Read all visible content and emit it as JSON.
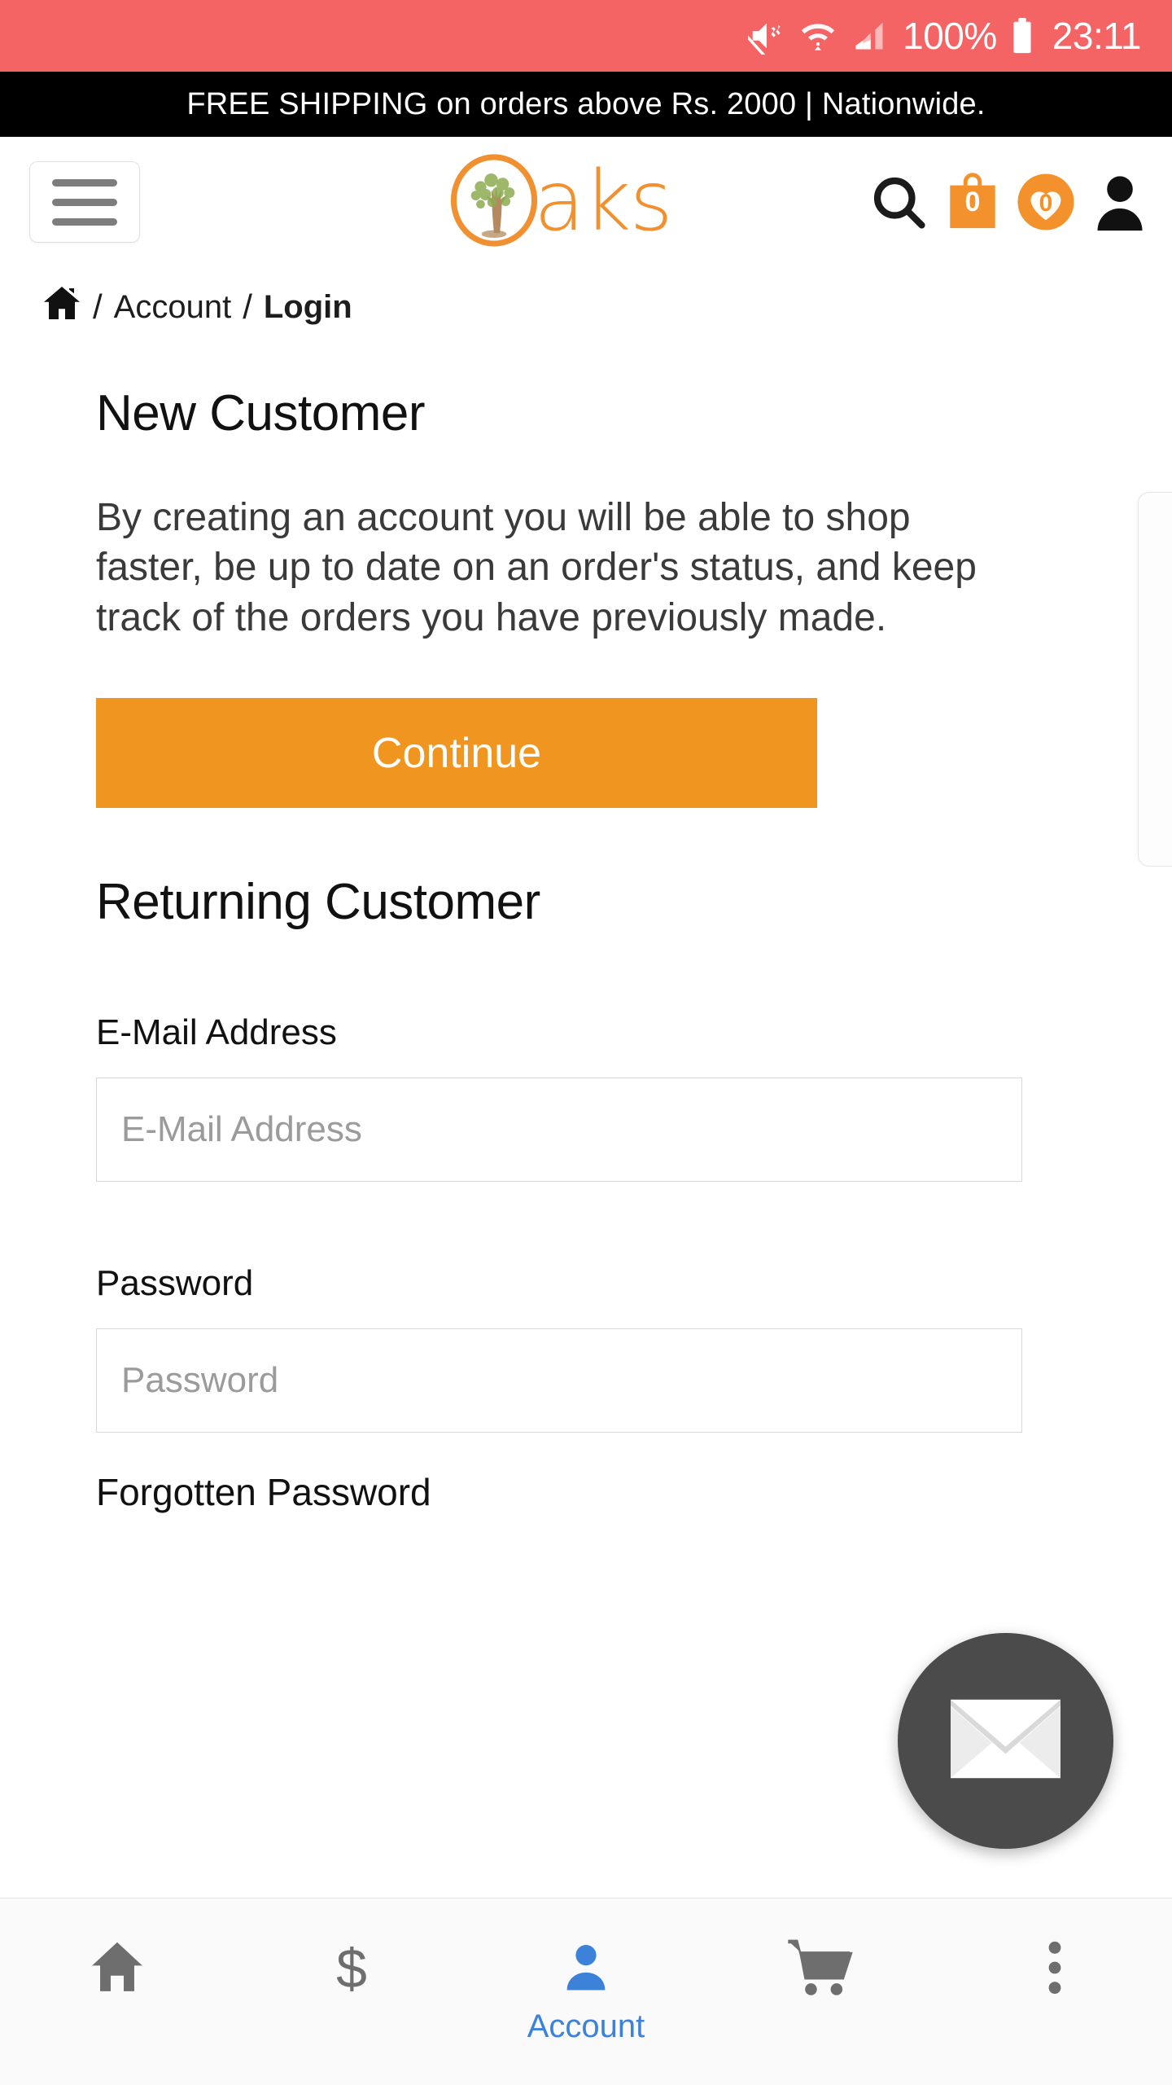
{
  "statusbar": {
    "icons": [
      "mute-icon",
      "wifi-icon",
      "signal-icon"
    ],
    "battery_percent": "100%",
    "battery_icon": "battery-full-icon",
    "time": "23:11",
    "background_color": "#f56464"
  },
  "promo_banner": {
    "text": "FREE SHIPPING on orders above Rs. 2000 | Nationwide.",
    "background_color": "#000000",
    "text_color": "#ffffff"
  },
  "header": {
    "menu_button_name": "hamburger-menu-button",
    "logo_text": "aks",
    "logo_mark": "oak-tree-in-circle-icon",
    "brand_color": "#f09030",
    "icons": {
      "search": "search-icon",
      "cart_count": "0",
      "wishlist_count": "0",
      "account": "person-icon"
    }
  },
  "breadcrumb": {
    "home_icon": "home-icon",
    "separator": "/",
    "items": [
      {
        "label": "Account",
        "active": false
      },
      {
        "label": "Login",
        "active": true
      }
    ]
  },
  "main": {
    "new_customer": {
      "heading": "New Customer",
      "body": "By creating an account you will be able to shop faster, be up to date on an order's status, and keep track of the orders you have previously made.",
      "continue_label": "Continue",
      "continue_color": "#f0951f"
    },
    "returning_customer": {
      "heading": "Returning Customer",
      "email_label": "E-Mail Address",
      "email_value": "",
      "email_placeholder": "E-Mail Address",
      "password_label": "Password",
      "password_value": "",
      "password_placeholder": "Password",
      "forgotten_password_label": "Forgotten Password"
    }
  },
  "fab": {
    "icon": "envelope-icon",
    "background_color": "#4b4b4b"
  },
  "bottom_nav": {
    "active_color": "#3b82d8",
    "inactive_color": "#6e6e6e",
    "items": [
      {
        "icon": "home-icon",
        "label": "",
        "active": false
      },
      {
        "icon": "dollar-icon",
        "label": "",
        "active": false
      },
      {
        "icon": "account-person-icon",
        "label": "Account",
        "active": true
      },
      {
        "icon": "cart-icon",
        "label": "",
        "active": false
      },
      {
        "icon": "more-vertical-icon",
        "label": "",
        "active": false
      }
    ]
  }
}
